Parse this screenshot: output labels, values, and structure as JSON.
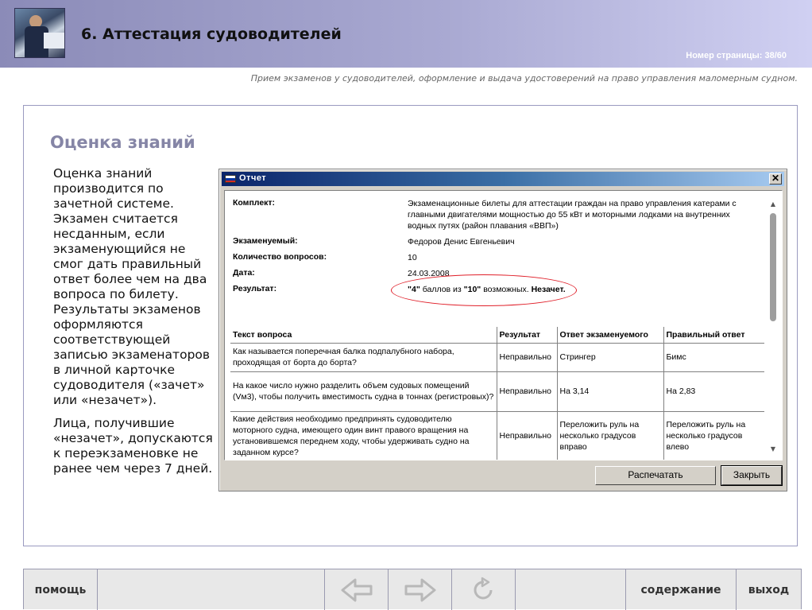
{
  "header": {
    "title": "6. Аттестация судоводителей",
    "page_number": "Номер страницы: 38/60"
  },
  "subtitle": "Прием экзаменов у судоводителей, оформление и выдача удостоверений на право управления маломерным судном.",
  "section": {
    "title": "Оценка знаний",
    "paragraph1": "Оценка знаний производится по зачетной системе. Экзамен считается несданным, если экзаменующийся не смог дать правильный ответ более чем на два вопроса по билету. Результаты экзаменов оформляются соответствующей записью экзаменаторов в личной карточке судоводителя («зачет» или «незачет»).",
    "paragraph2": "Лица, получившие «незачет», допускаются к переэкзаменовке не ранее чем через 7 дней."
  },
  "dialog": {
    "title": "Отчет",
    "close_symbol": "✕",
    "fields": {
      "kit_label": "Комплект:",
      "kit_value": "Экзаменационные билеты для аттестации граждан на право управления катерами с главными двигателями мощностью до 55 кВт и моторными лодками на внутренних водных путях (район плавания «ВВП»)",
      "examinee_label": "Экзаменуемый:",
      "examinee_value": "Федоров Денис Евгеньевич",
      "count_label": "Количество вопросов:",
      "count_value": "10",
      "date_label": "Дата:",
      "date_value": "24.03.2008",
      "result_label": "Результат:",
      "result_score": "\"4\"",
      "result_mid": " баллов из ",
      "result_max": "\"10\"",
      "result_tail": " возможных. ",
      "result_verdict": "Незачет."
    },
    "table": {
      "headers": [
        "Текст вопроса",
        "Результат",
        "Ответ экзаменуемого",
        "Правильный ответ"
      ],
      "rows": [
        {
          "question": "Как называется поперечная балка подпалубного набора, проходящая от борта до борта?",
          "result": "Неправильно",
          "answer": "Стрингер",
          "correct": "Бимс"
        },
        {
          "question": "На какое число нужно разделить объем судовых помещений (Vм3), чтобы получить вместимость судна в тоннах (регистровых)?",
          "result": "Неправильно",
          "answer": "На 3,14",
          "correct": "На 2,83"
        },
        {
          "question": "Какие действия необходимо предпринять судоводителю моторного судна, имеющего один винт правого вращения на установившемся переднем ходу, чтобы удерживать судно на заданном курсе?",
          "result": "Неправильно",
          "answer": "Переложить руль на несколько градусов вправо",
          "correct": "Переложить руль на несколько градусов влево"
        }
      ]
    },
    "buttons": {
      "print": "Распечатать",
      "close": "Закрыть"
    }
  },
  "footer": {
    "help": "помощь",
    "contents": "содержание",
    "exit": "выход"
  },
  "colors": {
    "accent_title": "#8585a6",
    "ellipse": "#e0202a",
    "header_start": "#8b8bb8",
    "header_end": "#d0d0f2"
  }
}
